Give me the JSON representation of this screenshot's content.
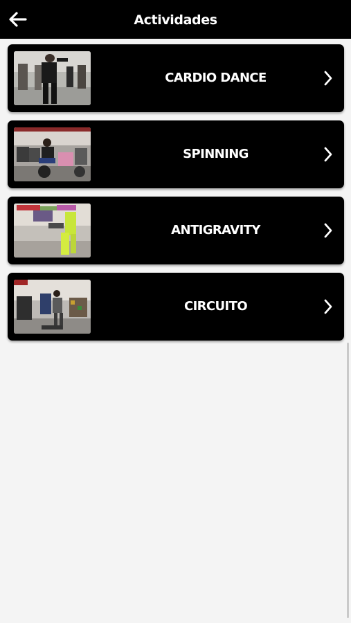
{
  "header": {
    "title": "Actividades",
    "back_icon": "arrow-left-icon",
    "background": "#000000",
    "text_color": "#ffffff"
  },
  "activities": [
    {
      "label": "CARDIO DANCE",
      "image": "cardio-dance-photo",
      "chevron_icon": "chevron-right-icon"
    },
    {
      "label": "SPINNING",
      "image": "spinning-photo",
      "chevron_icon": "chevron-right-icon"
    },
    {
      "label": "ANTIGRAVITY",
      "image": "antigravity-photo",
      "chevron_icon": "chevron-right-icon"
    },
    {
      "label": "CIRCUITO",
      "image": "circuito-photo",
      "chevron_icon": "chevron-right-icon"
    }
  ],
  "colors": {
    "page_background": "#f4f4f4",
    "card_background": "#000000",
    "card_text": "#ffffff"
  }
}
